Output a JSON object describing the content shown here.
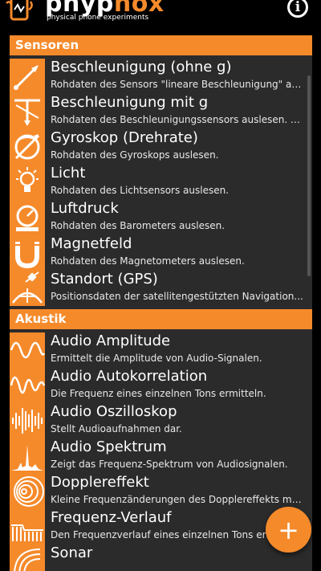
{
  "header": {
    "brand_part1": "phyp",
    "brand_part2": "hox",
    "tagline": "physical phone experiments",
    "info_label": "i"
  },
  "sections": [
    {
      "title": "Sensoren",
      "items": [
        {
          "title": "Beschleunigung (ohne g)",
          "desc": "Rohdaten des Sensors \"lineare Beschleunigung\" au...",
          "icon": "acceleration-without-g-icon"
        },
        {
          "title": "Beschleunigung mit g",
          "desc": "Rohdaten des Beschleunigungssensors auslesen. D...",
          "icon": "acceleration-with-g-icon"
        },
        {
          "title": "Gyroskop (Drehrate)",
          "desc": "Rohdaten des Gyroskops auslesen.",
          "icon": "gyroscope-icon"
        },
        {
          "title": "Licht",
          "desc": "Rohdaten des Lichtsensors auslesen.",
          "icon": "light-bulb-icon"
        },
        {
          "title": "Luftdruck",
          "desc": "Rohdaten des Barometers auslesen.",
          "icon": "barometer-icon"
        },
        {
          "title": "Magnetfeld",
          "desc": "Rohdaten des Magnetometers auslesen.",
          "icon": "magnet-icon"
        },
        {
          "title": "Standort (GPS)",
          "desc": "Positionsdaten der satellitengestützten Navigation...",
          "icon": "gps-satellite-icon"
        }
      ]
    },
    {
      "title": "Akustik",
      "items": [
        {
          "title": "Audio Amplitude",
          "desc": "Ermittelt die Amplitude von Audio-Signalen.",
          "icon": "sine-wave-icon"
        },
        {
          "title": "Audio Autokorrelation",
          "desc": "Die Frequenz eines einzelnen Tons ermitteln.",
          "icon": "autocorrelation-icon"
        },
        {
          "title": "Audio Oszilloskop",
          "desc": "Stellt Audioaufnahmen dar.",
          "icon": "oscilloscope-icon"
        },
        {
          "title": "Audio Spektrum",
          "desc": "Zeigt das Frequenz-Spektrum von Audiosignalen.",
          "icon": "spectrum-icon"
        },
        {
          "title": "Dopplereffekt",
          "desc": "Kleine Frequenzänderungen des Dopplereffekts me...",
          "icon": "doppler-icon"
        },
        {
          "title": "Frequenz-Verlauf",
          "desc": "Den Frequenzverlauf eines einzelnen Tons ermittel...",
          "icon": "frequency-history-icon"
        },
        {
          "title": "Sonar",
          "desc": "",
          "icon": "sonar-icon"
        }
      ]
    }
  ],
  "fab": {
    "label": "+"
  },
  "colors": {
    "accent": "#f58a2b",
    "list_bg": "#2b2b2b",
    "background": "#000000"
  }
}
